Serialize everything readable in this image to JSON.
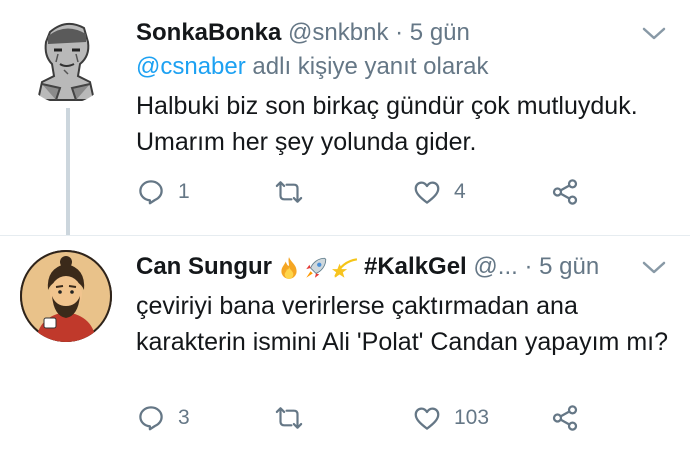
{
  "tweets": [
    {
      "name": "SonkaBonka",
      "handle": "@snkbnk",
      "dot": "·",
      "time": "5 gün",
      "reply_to_mention": "@csnaber",
      "reply_to_suffix": " adlı kişiye yanıt olarak",
      "text": "Halbuki biz son birkaç gündür çok mutluyduk. Umarım her şey yolunda gider.",
      "reply_count": "1",
      "retweet_count": "",
      "like_count": "4"
    },
    {
      "name": "Can Sungur",
      "emojis": [
        "fire",
        "rocket",
        "dizzy-star"
      ],
      "hashtag": "#KalkGel",
      "handle": "@...",
      "dot": "·",
      "time": "5 gün",
      "text": "çeviriyi bana verirlerse çaktırmadan ana karakterin ismini Ali 'Polat' Candan yapayım mı?",
      "reply_count": "3",
      "retweet_count": "",
      "like_count": "103"
    }
  ],
  "colors": {
    "text": "#14171a",
    "secondary": "#657786",
    "link": "#1da1f2",
    "thread_line": "#ccd6dd",
    "divider": "#e6ecf0"
  }
}
